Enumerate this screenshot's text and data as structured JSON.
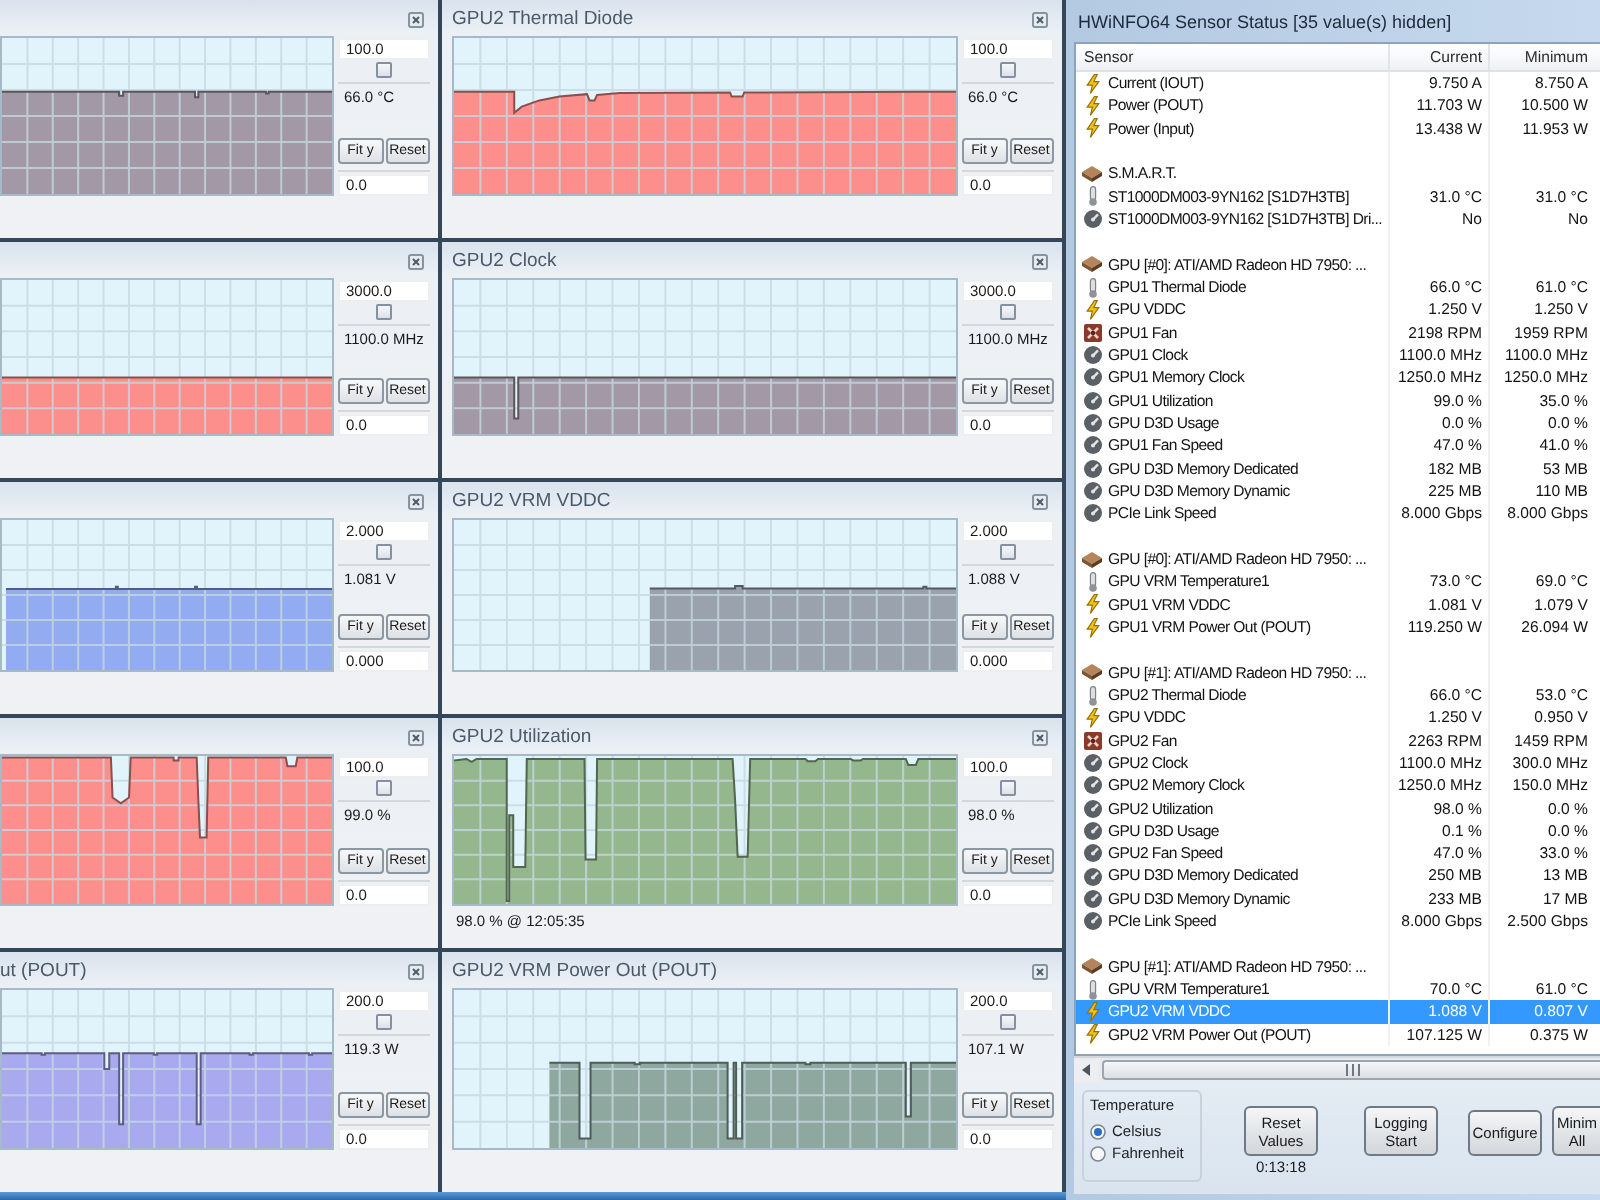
{
  "graph_rows": [
    {
      "panels": [
        {
          "color": "#a398a6",
          "max": "100.0",
          "checked": false,
          "current": "66.0 °C",
          "buttons": [
            "Fit y",
            "Reset"
          ],
          "min": "0.0"
        },
        {
          "title": "GPU2 Thermal Diode",
          "color": "#fc8f8c",
          "max": "100.0",
          "checked": false,
          "current": "66.0 °C",
          "buttons": [
            "Fit y",
            "Reset"
          ],
          "min": "0.0"
        }
      ]
    },
    {
      "panels": [
        {
          "color": "#fc8f8c",
          "max": "3000.0",
          "checked": false,
          "current": "1100.0 MHz",
          "buttons": [
            "Fit y",
            "Reset"
          ],
          "min": "0.0"
        },
        {
          "title": "GPU2 Clock",
          "color": "#a398a6",
          "max": "3000.0",
          "checked": false,
          "current": "1100.0 MHz",
          "buttons": [
            "Fit y",
            "Reset"
          ],
          "min": "0.0"
        }
      ]
    },
    {
      "panels": [
        {
          "color": "#93abf0",
          "max": "2.000",
          "checked": false,
          "current": "1.081 V",
          "buttons": [
            "Fit y",
            "Reset"
          ],
          "min": "0.000"
        },
        {
          "title": "GPU2 VRM VDDC",
          "color": "#9aa2ae",
          "max": "2.000",
          "checked": false,
          "current": "1.088 V",
          "buttons": [
            "Fit y",
            "Reset"
          ],
          "min": "0.000"
        }
      ]
    },
    {
      "panels": [
        {
          "color": "#fc8f8c",
          "max": "100.0",
          "checked": false,
          "current": "99.0 %",
          "buttons": [
            "Fit y",
            "Reset"
          ],
          "min": "0.0"
        },
        {
          "title": "GPU2 Utilization",
          "color": "#95b78e",
          "max": "100.0",
          "checked": false,
          "current": "98.0 %",
          "buttons": [
            "Fit y",
            "Reset"
          ],
          "min": "0.0",
          "status": "98.0 % @ 12:05:35"
        }
      ]
    },
    {
      "panels": [
        {
          "title": "ut (POUT)",
          "color": "#a9a9ef",
          "max": "200.0",
          "checked": false,
          "current": "119.3 W",
          "buttons": [
            "Fit y",
            "Reset"
          ],
          "min": "0.0"
        },
        {
          "title": "GPU2 VRM Power Out (POUT)",
          "color": "#8fa89f",
          "max": "200.0",
          "checked": false,
          "current": "107.1 W",
          "buttons": [
            "Fit y",
            "Reset"
          ],
          "min": "0.0"
        }
      ]
    }
  ],
  "sensor_window": {
    "title": "HWiNFO64 Sensor Status [35 value(s) hidden]",
    "columns": [
      "Sensor",
      "Current",
      "Minimum"
    ],
    "groups": [
      {
        "rows": [
          {
            "sensor": "Current (IOUT)",
            "current": "9.750 A",
            "minimum": "8.750 A",
            "kind": "electric",
            "selected": false
          },
          {
            "sensor": "Power (POUT)",
            "current": "11.703 W",
            "minimum": "10.500 W",
            "kind": "electric",
            "selected": false
          },
          {
            "sensor": "Power (Input)",
            "current": "13.438 W",
            "minimum": "11.953 W",
            "kind": "electric",
            "selected": false
          }
        ]
      },
      {
        "name": "S.M.A.R.T.",
        "rows": [
          {
            "sensor": "ST1000DM003-9YN162 [S1D7H3TB]",
            "current": "31.0 °C",
            "minimum": "31.0 °C",
            "kind": "temperature",
            "selected": false
          },
          {
            "sensor": "ST1000DM003-9YN162 [S1D7H3TB] Dri...",
            "current": "No",
            "minimum": "No",
            "kind": "other",
            "selected": false
          }
        ]
      },
      {
        "name": "GPU [#0]: ATI/AMD Radeon HD 7950: ...",
        "rows": [
          {
            "sensor": "GPU1 Thermal Diode",
            "current": "66.0 °C",
            "minimum": "61.0 °C",
            "kind": "temperature",
            "selected": false
          },
          {
            "sensor": "GPU VDDC",
            "current": "1.250 V",
            "minimum": "1.250 V",
            "kind": "electric",
            "selected": false
          },
          {
            "sensor": "GPU1 Fan",
            "current": "2198 RPM",
            "minimum": "1959 RPM",
            "kind": "fan",
            "selected": false
          },
          {
            "sensor": "GPU1 Clock",
            "current": "1100.0 MHz",
            "minimum": "1100.0 MHz",
            "kind": "other",
            "selected": false
          },
          {
            "sensor": "GPU1 Memory Clock",
            "current": "1250.0 MHz",
            "minimum": "1250.0 MHz",
            "kind": "other",
            "selected": false
          },
          {
            "sensor": "GPU1 Utilization",
            "current": "99.0 %",
            "minimum": "35.0 %",
            "kind": "other",
            "selected": false
          },
          {
            "sensor": "GPU D3D Usage",
            "current": "0.0 %",
            "minimum": "0.0 %",
            "kind": "other",
            "selected": false
          },
          {
            "sensor": "GPU1 Fan Speed",
            "current": "47.0 %",
            "minimum": "41.0 %",
            "kind": "other",
            "selected": false
          },
          {
            "sensor": "GPU D3D Memory Dedicated",
            "current": "182 MB",
            "minimum": "53 MB",
            "kind": "other",
            "selected": false
          },
          {
            "sensor": "GPU D3D Memory Dynamic",
            "current": "225 MB",
            "minimum": "110 MB",
            "kind": "other",
            "selected": false
          },
          {
            "sensor": "PCIe Link Speed",
            "current": "8.000 Gbps",
            "minimum": "8.000 Gbps",
            "kind": "other",
            "selected": false
          }
        ]
      },
      {
        "name": "GPU [#0]: ATI/AMD Radeon HD 7950: ...",
        "rows": [
          {
            "sensor": "GPU VRM Temperature1",
            "current": "73.0 °C",
            "minimum": "69.0 °C",
            "kind": "temperature",
            "selected": false
          },
          {
            "sensor": "GPU1 VRM VDDC",
            "current": "1.081 V",
            "minimum": "1.079 V",
            "kind": "electric",
            "selected": false
          },
          {
            "sensor": "GPU1 VRM Power Out (POUT)",
            "current": "119.250 W",
            "minimum": "26.094 W",
            "kind": "electric",
            "selected": false
          }
        ]
      },
      {
        "name": "GPU [#1]: ATI/AMD Radeon HD 7950: ...",
        "rows": [
          {
            "sensor": "GPU2 Thermal Diode",
            "current": "66.0 °C",
            "minimum": "53.0 °C",
            "kind": "temperature",
            "selected": false
          },
          {
            "sensor": "GPU VDDC",
            "current": "1.250 V",
            "minimum": "0.950 V",
            "kind": "electric",
            "selected": false
          },
          {
            "sensor": "GPU2 Fan",
            "current": "2263 RPM",
            "minimum": "1459 RPM",
            "kind": "fan",
            "selected": false
          },
          {
            "sensor": "GPU2 Clock",
            "current": "1100.0 MHz",
            "minimum": "300.0 MHz",
            "kind": "other",
            "selected": false
          },
          {
            "sensor": "GPU2 Memory Clock",
            "current": "1250.0 MHz",
            "minimum": "150.0 MHz",
            "kind": "other",
            "selected": false
          },
          {
            "sensor": "GPU2 Utilization",
            "current": "98.0 %",
            "minimum": "0.0 %",
            "kind": "other",
            "selected": false
          },
          {
            "sensor": "GPU D3D Usage",
            "current": "0.1 %",
            "minimum": "0.0 %",
            "kind": "other",
            "selected": false
          },
          {
            "sensor": "GPU2 Fan Speed",
            "current": "47.0 %",
            "minimum": "33.0 %",
            "kind": "other",
            "selected": false
          },
          {
            "sensor": "GPU D3D Memory Dedicated",
            "current": "250 MB",
            "minimum": "13 MB",
            "kind": "other",
            "selected": false
          },
          {
            "sensor": "GPU D3D Memory Dynamic",
            "current": "233 MB",
            "minimum": "17 MB",
            "kind": "other",
            "selected": false
          },
          {
            "sensor": "PCIe Link Speed",
            "current": "8.000 Gbps",
            "minimum": "2.500 Gbps",
            "kind": "other",
            "selected": false
          }
        ]
      },
      {
        "name": "GPU [#1]: ATI/AMD Radeon HD 7950: ...",
        "rows": [
          {
            "sensor": "GPU VRM Temperature1",
            "current": "70.0 °C",
            "minimum": "61.0 °C",
            "kind": "temperature",
            "selected": false
          },
          {
            "sensor": "GPU2 VRM VDDC",
            "current": "1.088 V",
            "minimum": "0.807 V",
            "kind": "electric",
            "selected": true
          },
          {
            "sensor": "GPU2 VRM Power Out (POUT)",
            "current": "107.125 W",
            "minimum": "0.375 W",
            "kind": "electric",
            "selected": false
          }
        ]
      }
    ],
    "temperature": {
      "label": "Temperature",
      "options": [
        {
          "label": "Celsius",
          "selected": true
        },
        {
          "label": "Fahrenheit",
          "selected": false
        }
      ]
    },
    "buttons": [
      {
        "label": "Reset Values",
        "caption": "0:13:18"
      },
      {
        "label": "Logging Start"
      },
      {
        "label": "Configure"
      },
      {
        "label": "Minim All"
      }
    ]
  }
}
